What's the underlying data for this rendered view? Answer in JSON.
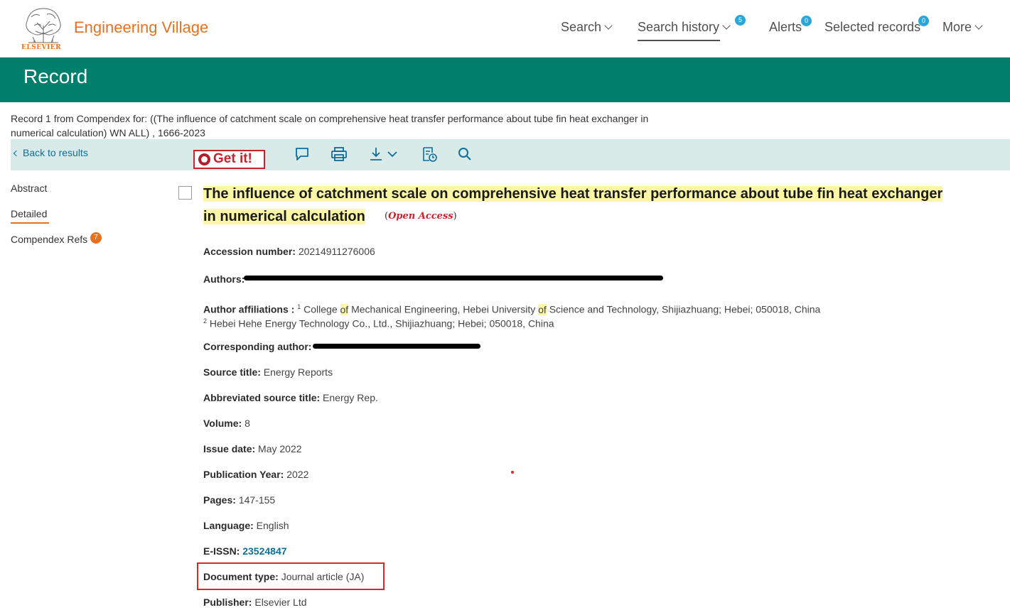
{
  "header": {
    "publisher_word": "ELSEVIER",
    "brand": "Engineering Village",
    "nav": {
      "search": "Search",
      "search_history": "Search history",
      "search_history_count": "5",
      "alerts": "Alerts",
      "alerts_count": "0",
      "selected_records": "Selected records",
      "selected_records_count": "0",
      "more": "More"
    }
  },
  "banner": {
    "title": "Record"
  },
  "record_info": "Record 1 from Compendex for: ((The influence of catchment scale on comprehensive heat transfer performance about tube fin heat exchanger in numerical calculation) WN ALL) , 1666-2023",
  "toolbar": {
    "back": "Back to results",
    "getit": "Get it!",
    "icons": [
      "comment-icon",
      "print-icon",
      "download-icon",
      "cite-icon",
      "search-icon"
    ]
  },
  "sidebar": {
    "abstract": "Abstract",
    "detailed": "Detailed",
    "compendex_refs": "Compendex Refs",
    "compendex_refs_count": "7"
  },
  "record": {
    "title_line1": "The influence of catchment scale on comprehensive heat transfer performance about tube fin heat exchanger",
    "title_line2": "in numerical calculation",
    "open_access": "Open Access",
    "accession_label": "Accession number:",
    "accession": "20214911276006",
    "authors_label": "Authors:",
    "affiliations_label": "Author affiliations :",
    "aff1_num": "1",
    "aff1_p1": "College",
    "aff1_of1": "of",
    "aff1_p2": "Mechanical Engineering, Hebei University",
    "aff1_of2": "of",
    "aff1_p3": "Science and Technology, Shijiazhuang; Hebei; 050018, China",
    "aff2_num": "2",
    "aff2": "Hebei Hehe Energy Technology Co., Ltd., Shijiazhuang; Hebei; 050018, China",
    "corresponding_label": "Corresponding author:",
    "source_label": "Source title:",
    "source": "Energy Reports",
    "abbrev_label": "Abbreviated source title:",
    "abbrev": "Energy Rep.",
    "volume_label": "Volume:",
    "volume": "8",
    "issue_label": "Issue date:",
    "issue": "May 2022",
    "pubyear_label": "Publication Year:",
    "pubyear": "2022",
    "pages_label": "Pages:",
    "pages": "147-155",
    "language_label": "Language:",
    "language": "English",
    "eissn_label": "E-ISSN:",
    "eissn": "23524847",
    "doctype_label": "Document type:",
    "doctype": "Journal article (JA)",
    "publisher_label": "Publisher:",
    "publisher": "Elsevier Ltd"
  },
  "colors": {
    "brand_orange": "#e9711c",
    "banner_green": "#007f6d",
    "toolbar_bg": "#d9ebe8",
    "link_blue": "#0e6e9c",
    "highlight_yellow": "#fbf7a6",
    "alert_red": "#d42a2a"
  }
}
